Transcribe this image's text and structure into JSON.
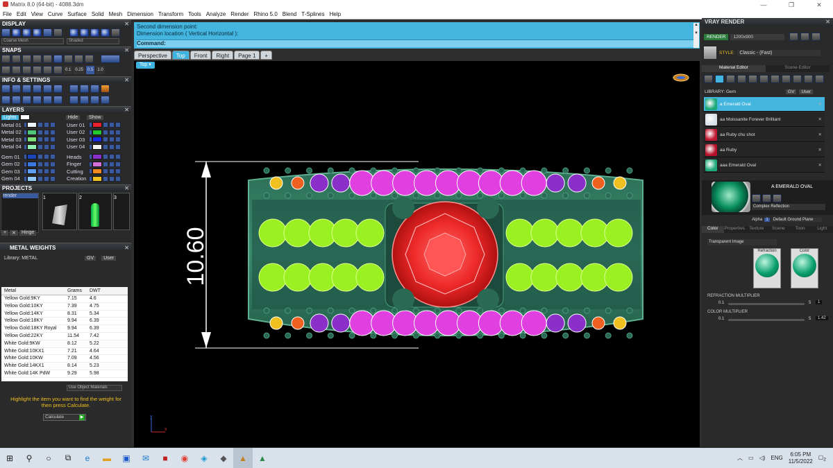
{
  "window": {
    "title": "Matrix 8.0 (64-bit) - 4088.3dm",
    "controls": [
      "—",
      "❐",
      "✕"
    ]
  },
  "menu": [
    "File",
    "Edit",
    "View",
    "Curve",
    "Surface",
    "Solid",
    "Mesh",
    "Dimension",
    "Transform",
    "Tools",
    "Analyze",
    "Render",
    "Rhino 5.0",
    "Blend",
    "T-Splines",
    "Help"
  ],
  "left": {
    "display_title": "DISPLAY",
    "display_selects": [
      "Coarse Mesh",
      "Shaded"
    ],
    "snaps_title": "SNAPS",
    "snaps_values": [
      "0.1",
      "0.25",
      "0.5",
      "1.0"
    ],
    "info_title": "INFO & SETTINGS",
    "layers_title": "LAYERS",
    "layers_lights": "Lights",
    "layers_hide": "Hide",
    "layers_show": "Show",
    "layers_left": [
      {
        "name": "Metal 01",
        "color": "#e8f4f8"
      },
      {
        "name": "Metal 02",
        "color": "#52c57c"
      },
      {
        "name": "Metal 03",
        "color": "#7fe07a"
      },
      {
        "name": "Metal 04",
        "color": "#8ff0b0"
      },
      {
        "name": "Gem 01",
        "color": "#1a44b8"
      },
      {
        "name": "Gem 02",
        "color": "#3a78e0"
      },
      {
        "name": "Gem 03",
        "color": "#5fa0f0"
      },
      {
        "name": "Gem 04",
        "color": "#90c8f8"
      }
    ],
    "layers_right": [
      {
        "name": "User 01",
        "color": "#e8202c"
      },
      {
        "name": "User 02",
        "color": "#22c830"
      },
      {
        "name": "User 03",
        "color": "#1a2ae0"
      },
      {
        "name": "User 04",
        "color": "#f0f0f0"
      },
      {
        "name": "Heads",
        "color": "#8a30c8"
      },
      {
        "name": "Finger",
        "color": "#d070d8"
      },
      {
        "name": "Cutting",
        "color": "#f08a20"
      },
      {
        "name": "Creation",
        "color": "#f0c020"
      }
    ],
    "projects_title": "PROJECTS",
    "projects_item": "render",
    "projects_numbers": [
      "1",
      "2",
      "3"
    ],
    "projects_buttons": [
      "+",
      "✕",
      "Hinge"
    ],
    "metal_title": "METAL WEIGHTS",
    "library_label": "Library: METAL",
    "lib_buttons": [
      "GV",
      "User"
    ],
    "table_headers": [
      "Metal",
      "Grams",
      "DWT"
    ],
    "table_rows": [
      [
        "Yellow Gold:9KY",
        "7.15",
        "4.6"
      ],
      [
        "Yellow Gold:10KY",
        "7.39",
        "4.75"
      ],
      [
        "Yellow Gold:14KY",
        "8.31",
        "5.34"
      ],
      [
        "Yellow Gold:18KY",
        "9.94",
        "6.39"
      ],
      [
        "Yellow Gold:18KY Royal",
        "9.94",
        "6.39"
      ],
      [
        "Yellow Gold:22KY",
        "11.54",
        "7.42"
      ],
      [
        "White Gold:9KW",
        "8.12",
        "5.22"
      ],
      [
        "White Gold:10KX1",
        "7.21",
        "4.64"
      ],
      [
        "White Gold:10KW",
        "7.09",
        "4.56"
      ],
      [
        "White Gold:14KX1",
        "8.14",
        "5.23"
      ],
      [
        "White Gold:14K PdW",
        "9.29",
        "5.98"
      ]
    ],
    "use_object": "Use Object Materials",
    "highlight": "Highlight the item you want to find the weight for then press Calculate.",
    "calculate": "Calculate"
  },
  "command": {
    "line1": "Second dimension point:",
    "line2": "Dimension location ( Vertical  Horizontal ):",
    "prompt": "Command:"
  },
  "tabs": [
    "Perspective",
    "Top",
    "Front",
    "Right",
    "Page 1",
    "+"
  ],
  "viewport": {
    "label": "Top",
    "dimension": "10.60",
    "axis_y": "y",
    "axis_x": "x"
  },
  "vray": {
    "title": "VRAY RENDER",
    "render_btn": "RENDER",
    "resolution": "1200x900",
    "style_label": "STYLE:",
    "style_value": "Classic - (Fast)",
    "tabs": [
      "Material Editor",
      "Scene Editor"
    ],
    "library": "LIBRARY: Gem",
    "lib_buttons": [
      "GV",
      "User"
    ],
    "materials": [
      {
        "name": "a Emerald Oval",
        "color": "#1aa878",
        "selected": true
      },
      {
        "name": "aa Moissanite Forever Brilliant",
        "color": "#d8e0e8",
        "selected": false
      },
      {
        "name": "aa Ruby chu shot",
        "color": "#c01830",
        "selected": false
      },
      {
        "name": "aa Ruby",
        "color": "#b81028",
        "selected": false
      },
      {
        "name": "aaa Emerald Oval",
        "color": "#20a878",
        "selected": false
      }
    ],
    "preview_name": "A EMERALD OVAL",
    "reflection": "Complex Reflection",
    "alpha_label": "Alpha",
    "alpha_value": "1",
    "ground": "Default Ground Plane",
    "subtabs": [
      "Color",
      "Properties",
      "Texture",
      "Scene",
      "Toon",
      "Light"
    ],
    "transparent": "Transparent Image",
    "refraction_label": "Refraction",
    "color_label": "Color",
    "refraction_mult": "REFRACTION MULTIPLIER",
    "ref_min": "0.1",
    "ref_max": "5",
    "ref_val": "1",
    "color_mult": "COLOR MULTIPLIER",
    "col_min": "0.1",
    "col_max": "5",
    "col_val": "1.42"
  },
  "taskbar": {
    "lang": "ENG",
    "time": "6:05 PM",
    "date": "11/5/2022",
    "notif": "2"
  }
}
